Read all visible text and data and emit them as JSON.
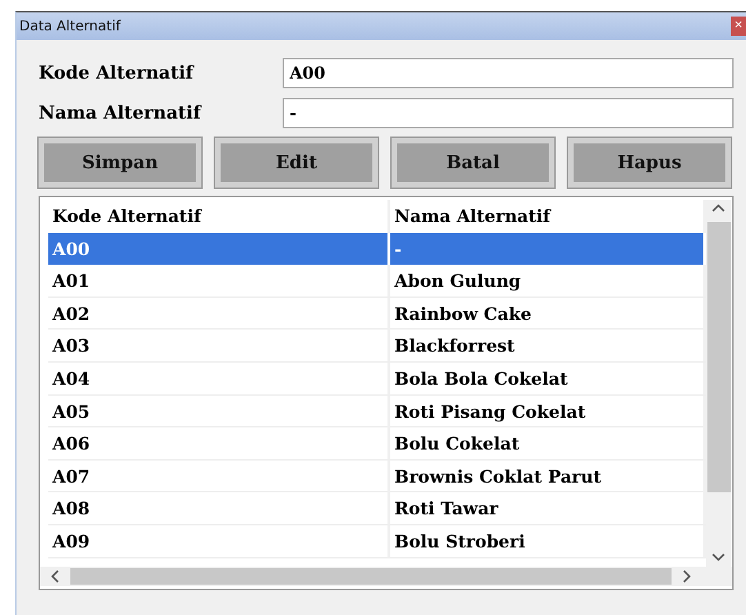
{
  "window": {
    "title": "Data Alternatif",
    "close": "×"
  },
  "form": [
    {
      "label": "Kode Alternatif",
      "value": "A00"
    },
    {
      "label": "Nama Alternatif",
      "value": "-"
    }
  ],
  "buttons": [
    "Simpan",
    "Edit",
    "Batal",
    "Hapus"
  ],
  "table": {
    "columns": [
      "Kode Alternatif",
      "Nama Alternatif"
    ],
    "rows": [
      {
        "cells": [
          "A00",
          "-"
        ],
        "selected": true
      },
      {
        "cells": [
          "A01",
          "Abon Gulung"
        ],
        "selected": false
      },
      {
        "cells": [
          "A02",
          "Rainbow Cake"
        ],
        "selected": false
      },
      {
        "cells": [
          "A03",
          "Blackforrest"
        ],
        "selected": false
      },
      {
        "cells": [
          "A04",
          "Bola Bola Cokelat"
        ],
        "selected": false
      },
      {
        "cells": [
          "A05",
          "Roti Pisang Cokelat"
        ],
        "selected": false
      },
      {
        "cells": [
          "A06",
          "Bolu Cokelat"
        ],
        "selected": false
      },
      {
        "cells": [
          "A07",
          "Brownis Coklat Parut"
        ],
        "selected": false
      },
      {
        "cells": [
          "A08",
          "Roti Tawar"
        ],
        "selected": false
      },
      {
        "cells": [
          "A09",
          "Bolu Stroberi"
        ],
        "selected": false
      }
    ]
  }
}
